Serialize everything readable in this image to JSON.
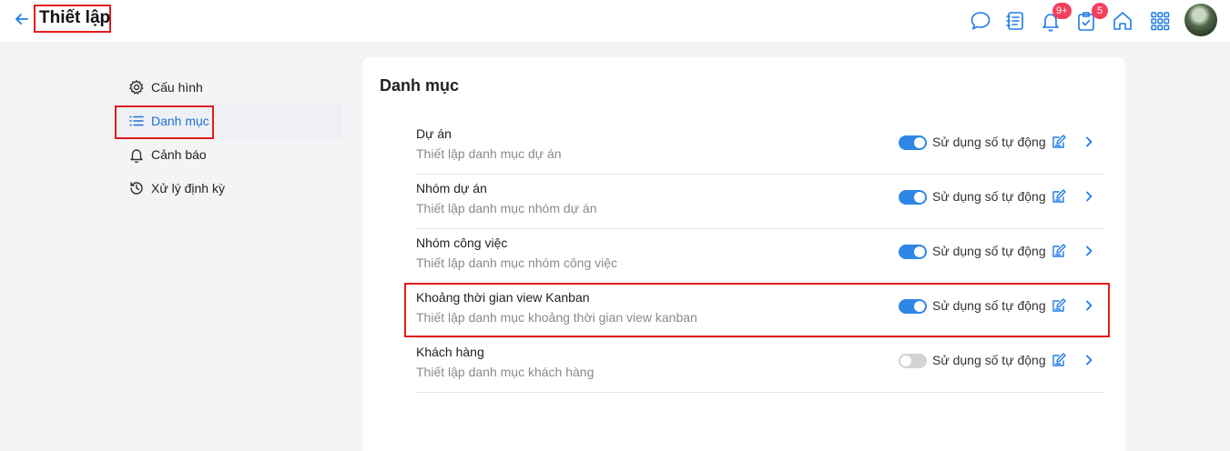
{
  "header": {
    "title": "Thiết lập",
    "icons": [
      "back-arrow-icon",
      "chat-icon",
      "notes-icon",
      "bell-icon",
      "clipboard-check-icon",
      "home-icon",
      "apps-grid-icon"
    ],
    "notification_badge": "9+",
    "task_badge": "5"
  },
  "sidebar": {
    "items": [
      {
        "label": "Cấu hình",
        "icon": "gear-icon"
      },
      {
        "label": "Danh mục",
        "icon": "list-icon",
        "active": true
      },
      {
        "label": "Cảnh báo",
        "icon": "bell-icon"
      },
      {
        "label": "Xử lý định kỳ",
        "icon": "history-icon"
      }
    ]
  },
  "main": {
    "title": "Danh mục",
    "rows": [
      {
        "title": "Dự án",
        "subtitle": "Thiết lập danh mục dự án",
        "toggle_label": "Sử dụng số tự động",
        "toggle_on": true
      },
      {
        "title": "Nhóm dự án",
        "subtitle": "Thiết lập danh mục nhóm dự án",
        "toggle_label": "Sử dụng số tự động",
        "toggle_on": true
      },
      {
        "title": "Nhóm công việc",
        "subtitle": "Thiết lập danh mục nhóm công việc",
        "toggle_label": "Sử dụng số tự động",
        "toggle_on": true
      },
      {
        "title": "Khoảng thời gian view Kanban",
        "subtitle": "Thiết lập danh mục khoảng thời gian view kanban",
        "toggle_label": "Sử dụng số tự động",
        "toggle_on": true
      },
      {
        "title": "Khách hàng",
        "subtitle": "Thiết lập danh mục khách hàng",
        "toggle_label": "Sử dụng số tự động",
        "toggle_on": false
      }
    ]
  },
  "colors": {
    "accent": "#1e7be8",
    "highlight_box": "#e31b1b",
    "badge": "#f5405c",
    "toggle_on": "#2f86e6",
    "toggle_off": "#d3d3d3"
  }
}
